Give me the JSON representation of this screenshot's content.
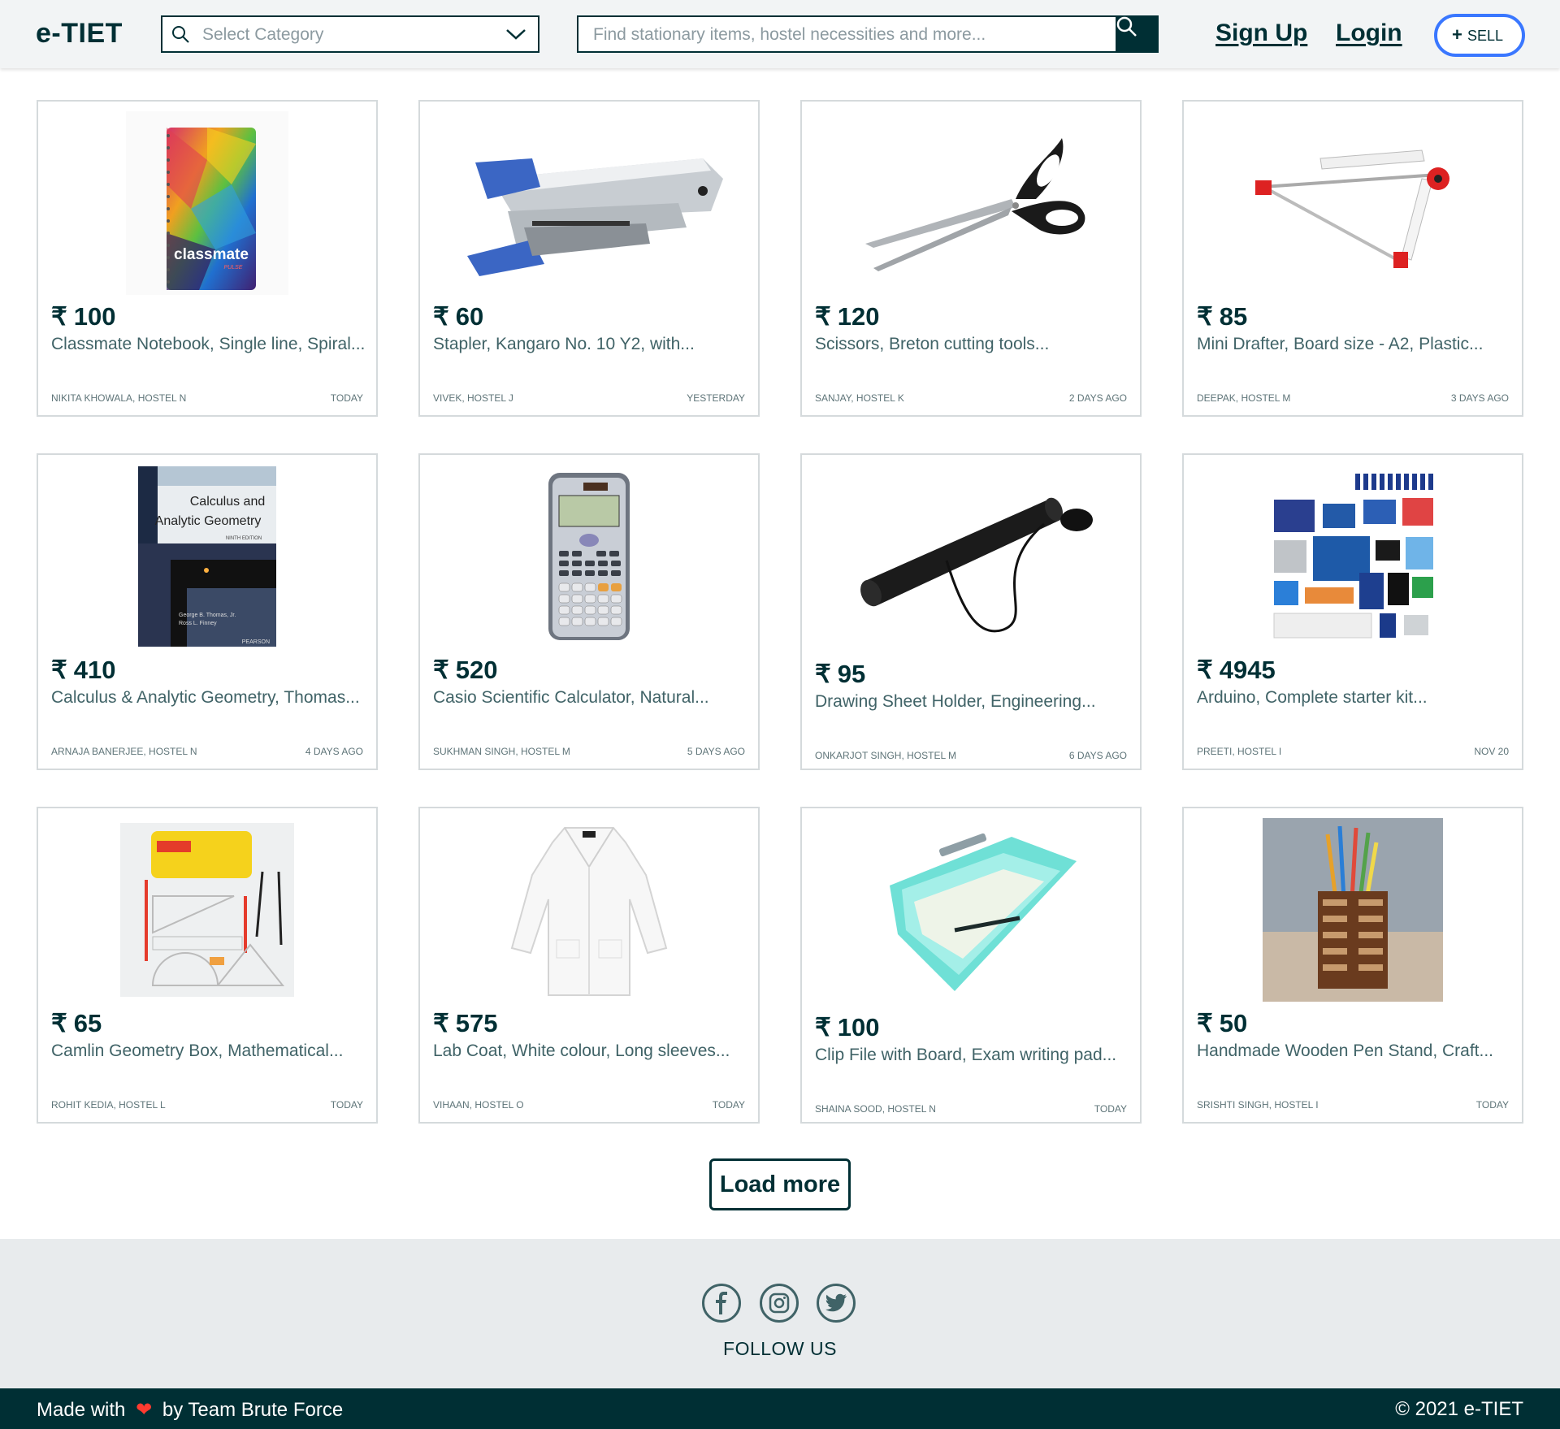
{
  "header": {
    "logo": "e-TIET",
    "category_placeholder": "Select Category",
    "search_placeholder": "Find stationary items, hostel necessities and more...",
    "signup_label": "Sign Up",
    "login_label": "Login",
    "sell_plus": "+",
    "sell_label": "SELL"
  },
  "currency_symbol": "₹",
  "products": [
    {
      "price": "100",
      "title": "Classmate Notebook, Single line, Spiral...",
      "seller": "NIKITA KHOWALA, HOSTEL N",
      "date": "TODAY",
      "image": "notebook-image"
    },
    {
      "price": "60",
      "title": "Stapler, Kangaro No. 10 Y2, with...",
      "seller": "VIVEK, HOSTEL J",
      "date": "YESTERDAY",
      "image": "stapler-image"
    },
    {
      "price": "120",
      "title": "Scissors, Breton cutting tools...",
      "seller": "SANJAY, HOSTEL K",
      "date": "2 DAYS AGO",
      "image": "scissors-image"
    },
    {
      "price": "85",
      "title": "Mini Drafter, Board size - A2, Plastic...",
      "seller": "DEEPAK, HOSTEL M",
      "date": "3 DAYS AGO",
      "image": "drafter-image"
    },
    {
      "price": "410",
      "title": "Calculus & Analytic Geometry, Thomas...",
      "seller": "ARNAJA BANERJEE, HOSTEL N",
      "date": "4 DAYS AGO",
      "image": "book-image"
    },
    {
      "price": "520",
      "title": "Casio Scientific Calculator, Natural...",
      "seller": "SUKHMAN SINGH, HOSTEL M",
      "date": "5 DAYS AGO",
      "image": "calculator-image"
    },
    {
      "price": "95",
      "title": "Drawing Sheet Holder, Engineering...",
      "seller": "ONKARJOT SINGH, HOSTEL M",
      "date": "6 DAYS AGO",
      "image": "sheet-holder-image"
    },
    {
      "price": "4945",
      "title": "Arduino, Complete starter kit...",
      "seller": "PREETI, HOSTEL I",
      "date": "NOV 20",
      "image": "arduino-kit-image"
    },
    {
      "price": "65",
      "title": "Camlin Geometry Box, Mathematical...",
      "seller": "ROHIT KEDIA, HOSTEL L",
      "date": "TODAY",
      "image": "geometry-box-image"
    },
    {
      "price": "575",
      "title": "Lab Coat, White colour, Long sleeves...",
      "seller": "VIHAAN, HOSTEL O",
      "date": "TODAY",
      "image": "lab-coat-image"
    },
    {
      "price": "100",
      "title": "Clip File with Board, Exam writing pad...",
      "seller": "SHAINA SOOD, HOSTEL N",
      "date": "TODAY",
      "image": "clip-file-image"
    },
    {
      "price": "50",
      "title": "Handmade Wooden Pen Stand, Craft...",
      "seller": "SRISHTI SINGH, HOSTEL I",
      "date": "TODAY",
      "image": "pen-stand-image"
    }
  ],
  "book_cover": {
    "title_line1": "Calculus and",
    "title_line2": "Analytic Geometry",
    "edition": "NINTH EDITION",
    "author1": "George B. Thomas, Jr.",
    "author2": "Ross L. Finney",
    "publisher": "PEARSON"
  },
  "notebook_cover": {
    "brand": "classmate",
    "sub": "PULSE"
  },
  "load_more_label": "Load more",
  "footer": {
    "follow_label": "FOLLOW US",
    "made_with": "Made with",
    "heart": "❤",
    "by_team": "by Team Brute Force",
    "copyright": "© 2021 e-TIET"
  },
  "colors": {
    "primary": "#002f34",
    "accent": "#3a77ff",
    "header_bg": "#f2f4f5",
    "footer_bg": "#e8ebed",
    "muted_text": "#406367"
  },
  "icons": {
    "category_search": "search-icon",
    "category_dropdown": "chevron-down-icon",
    "search_button": "search-icon",
    "social": [
      "facebook-icon",
      "instagram-icon",
      "twitter-icon"
    ],
    "heart": "heart-icon"
  }
}
